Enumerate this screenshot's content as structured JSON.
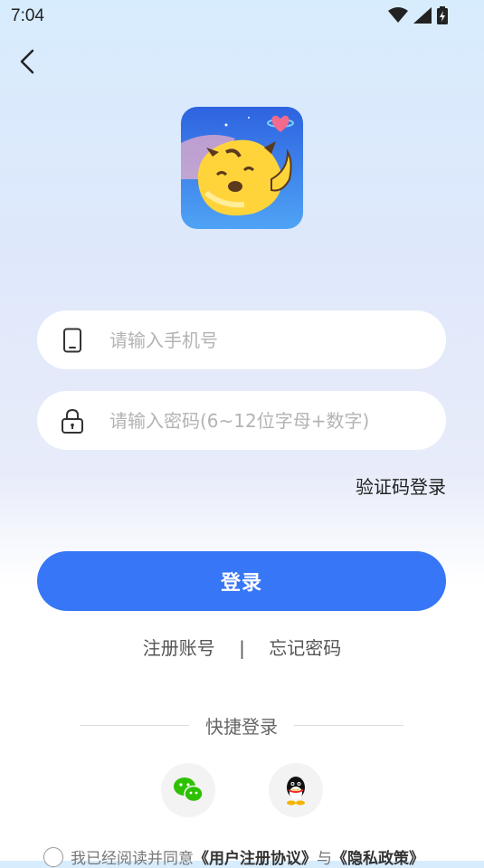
{
  "status_bar": {
    "time": "7:04"
  },
  "form": {
    "phone_placeholder": "请输入手机号",
    "password_placeholder": "请输入密码(6~12位字母+数字)",
    "sms_login_label": "验证码登录",
    "login_label": "登录"
  },
  "links": {
    "register": "注册账号",
    "separator": "|",
    "forgot": "忘记密码"
  },
  "quick_login": {
    "title": "快捷登录"
  },
  "agreement": {
    "prefix": "我已经阅读并同意",
    "user_agreement": "《用户注册协议》",
    "and": "与",
    "privacy": "《隐私政策》"
  },
  "colors": {
    "primary": "#3776f6",
    "wechat": "#2dc100"
  },
  "icons": [
    "back-arrow-icon",
    "phone-icon",
    "lock-icon",
    "wechat-icon",
    "qq-icon",
    "wifi-icon",
    "signal-icon",
    "battery-icon"
  ]
}
